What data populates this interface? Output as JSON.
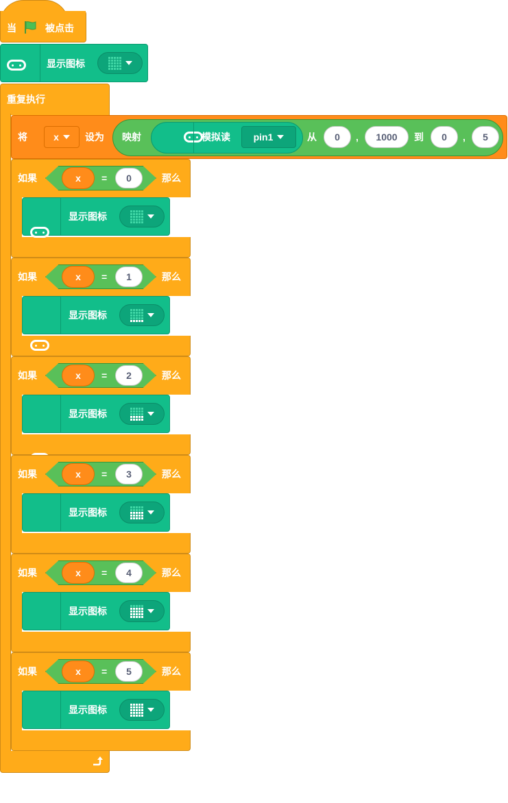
{
  "hat": {
    "when": "当",
    "clicked": "被点击",
    "flag_icon": "green-flag-icon"
  },
  "top_display": {
    "label": "显示图标",
    "icon": "microbit-icon",
    "lit_rows": 0
  },
  "loop": {
    "label": "重复执行",
    "end_icon": "loop-arrow-icon"
  },
  "set_block": {
    "set_word": "将",
    "variable": "x",
    "to_word": "设为",
    "map_word": "映射",
    "read_word": "模拟读",
    "pin": "pin1",
    "from_word": "从",
    "from_low": "0",
    "comma1": ",",
    "from_high": "1000",
    "to_range_word": "到",
    "to_low": "0",
    "comma2": ",",
    "to_high": "5"
  },
  "if_blocks": [
    {
      "if_word": "如果",
      "variable": "x",
      "op": "=",
      "value": "0",
      "then_word": "那么",
      "display_label": "显示图标",
      "lit_rows": 0
    },
    {
      "if_word": "如果",
      "variable": "x",
      "op": "=",
      "value": "1",
      "then_word": "那么",
      "display_label": "显示图标",
      "lit_rows": 1
    },
    {
      "if_word": "如果",
      "variable": "x",
      "op": "=",
      "value": "2",
      "then_word": "那么",
      "display_label": "显示图标",
      "lit_rows": 2
    },
    {
      "if_word": "如果",
      "variable": "x",
      "op": "=",
      "value": "3",
      "then_word": "那么",
      "display_label": "显示图标",
      "lit_rows": 3
    },
    {
      "if_word": "如果",
      "variable": "x",
      "op": "=",
      "value": "4",
      "then_word": "那么",
      "display_label": "显示图标",
      "lit_rows": 4
    },
    {
      "if_word": "如果",
      "variable": "x",
      "op": "=",
      "value": "5",
      "then_word": "那么",
      "display_label": "显示图标",
      "lit_rows": 5
    }
  ],
  "colors": {
    "control": "#ffab19",
    "variables": "#ff8c1a",
    "microbit": "#12be8a",
    "operators": "#59c059"
  }
}
